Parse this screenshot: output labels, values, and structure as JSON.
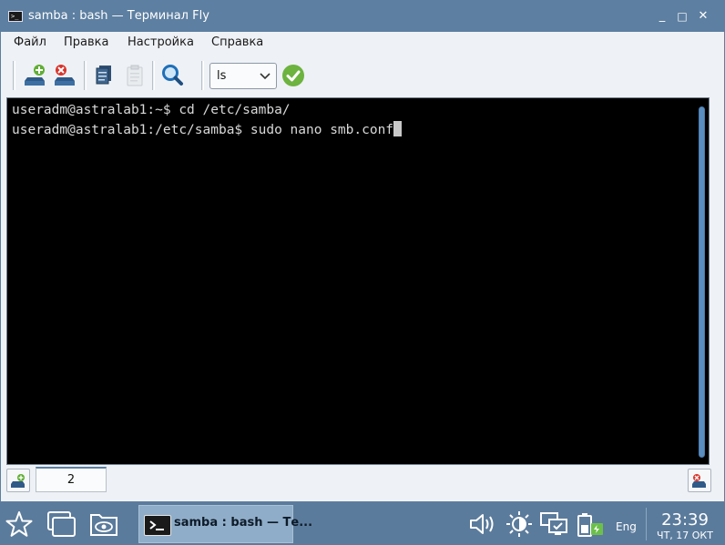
{
  "window": {
    "title": "samba : bash — Терминал Fly",
    "minimize": "_",
    "maximize": "□",
    "close": "✕"
  },
  "menu": {
    "items": [
      "Файл",
      "Правка",
      "Настройка",
      "Справка"
    ]
  },
  "toolbar": {
    "command_value": "ls",
    "buttons": [
      "new-session-icon",
      "close-session-icon",
      "copy-icon",
      "paste-icon",
      "search-icon",
      "execute-icon"
    ]
  },
  "terminal": {
    "lines": [
      "useradm@astralab1:~$ cd /etc/samba/",
      "useradm@astralab1:/etc/samba$ sudo nano smb.conf"
    ]
  },
  "tabs": {
    "items": [
      {
        "label": "2",
        "active": true
      }
    ]
  },
  "taskbar": {
    "task_label": "samba : bash — Те...",
    "language": "Eng",
    "time": "23:39",
    "date": "ЧТ, 17 ОКТ",
    "tray_icons": [
      "volume-icon",
      "brightness-icon",
      "network-icon",
      "battery-icon"
    ]
  },
  "colors": {
    "titlebar": "#5d7fa1",
    "terminal_bg": "#000000",
    "terminal_fg": "#d8d8d8",
    "taskbar": "#5b7b9c",
    "accent_green": "#6cb33f"
  }
}
